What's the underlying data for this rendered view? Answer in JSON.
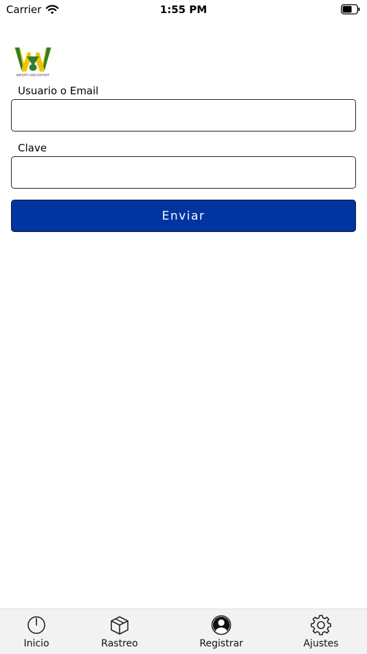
{
  "status_bar": {
    "carrier": "Carrier",
    "time": "1:55 PM"
  },
  "logo": {
    "text": "IMPORT AND EXPORT",
    "colors": {
      "green": "#2e7d32",
      "yellow": "#f2c200"
    }
  },
  "form": {
    "username_label": "Usuario o Email",
    "username_value": "",
    "password_label": "Clave",
    "password_value": "",
    "submit_label": "Enviar"
  },
  "tab_bar": {
    "items": [
      {
        "label": "Inicio",
        "icon": "power-icon"
      },
      {
        "label": "Rastreo",
        "icon": "package-icon"
      },
      {
        "label": "Registrar",
        "icon": "user-avatar-icon"
      },
      {
        "label": "Ajustes",
        "icon": "gear-icon"
      }
    ]
  },
  "colors": {
    "primary_button": "#0034a0",
    "tab_bar_bg": "#f2f2f2"
  }
}
